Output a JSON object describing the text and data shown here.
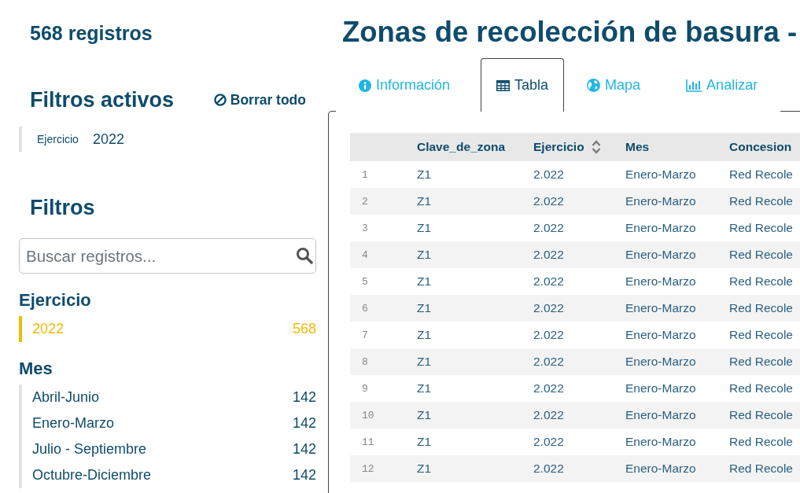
{
  "record_count": "568 registros",
  "active_filters": {
    "title": "Filtros activos",
    "clear_label": "Borrar todo",
    "items": [
      {
        "field": "Ejercicio",
        "value": "2022"
      }
    ]
  },
  "filters": {
    "title": "Filtros",
    "search": {
      "placeholder": "Buscar registros..."
    },
    "groups": [
      {
        "title": "Ejercicio",
        "options": [
          {
            "label": "2022",
            "count": "568",
            "selected": true
          }
        ]
      },
      {
        "title": "Mes",
        "options": [
          {
            "label": "Abril-Junio",
            "count": "142",
            "selected": false
          },
          {
            "label": "Enero-Marzo",
            "count": "142",
            "selected": false
          },
          {
            "label": "Julio - Septiembre",
            "count": "142",
            "selected": false
          },
          {
            "label": "Octubre-Diciembre",
            "count": "142",
            "selected": false
          }
        ]
      }
    ]
  },
  "page_title": "Zonas de recolección de basura -",
  "tabs": [
    {
      "label": "Información",
      "kind": "info",
      "selected": false
    },
    {
      "label": "Tabla",
      "kind": "table",
      "selected": true
    },
    {
      "label": "Mapa",
      "kind": "map",
      "selected": false
    },
    {
      "label": "Analizar",
      "kind": "analysis",
      "selected": false
    }
  ],
  "table": {
    "columns": [
      {
        "label": "Clave_de_zona",
        "sortable": false
      },
      {
        "label": "Ejercicio",
        "sortable": true
      },
      {
        "label": "Mes",
        "sortable": false
      },
      {
        "label": "Concesion",
        "sortable": false
      }
    ],
    "rows": [
      {
        "index": "1",
        "cells": [
          "Z1",
          "2.022",
          "Enero-Marzo",
          "Red Recole"
        ]
      },
      {
        "index": "2",
        "cells": [
          "Z1",
          "2.022",
          "Enero-Marzo",
          "Red Recole"
        ]
      },
      {
        "index": "3",
        "cells": [
          "Z1",
          "2.022",
          "Enero-Marzo",
          "Red Recole"
        ]
      },
      {
        "index": "4",
        "cells": [
          "Z1",
          "2.022",
          "Enero-Marzo",
          "Red Recole"
        ]
      },
      {
        "index": "5",
        "cells": [
          "Z1",
          "2.022",
          "Enero-Marzo",
          "Red Recole"
        ]
      },
      {
        "index": "6",
        "cells": [
          "Z1",
          "2.022",
          "Enero-Marzo",
          "Red Recole"
        ]
      },
      {
        "index": "7",
        "cells": [
          "Z1",
          "2.022",
          "Enero-Marzo",
          "Red Recole"
        ]
      },
      {
        "index": "8",
        "cells": [
          "Z1",
          "2.022",
          "Enero-Marzo",
          "Red Recole"
        ]
      },
      {
        "index": "9",
        "cells": [
          "Z1",
          "2.022",
          "Enero-Marzo",
          "Red Recole"
        ]
      },
      {
        "index": "10",
        "cells": [
          "Z1",
          "2.022",
          "Enero-Marzo",
          "Red Recole"
        ]
      },
      {
        "index": "11",
        "cells": [
          "Z1",
          "2.022",
          "Enero-Marzo",
          "Red Recole"
        ]
      },
      {
        "index": "12",
        "cells": [
          "Z1",
          "2.022",
          "Enero-Marzo",
          "Red Recole"
        ]
      }
    ]
  }
}
